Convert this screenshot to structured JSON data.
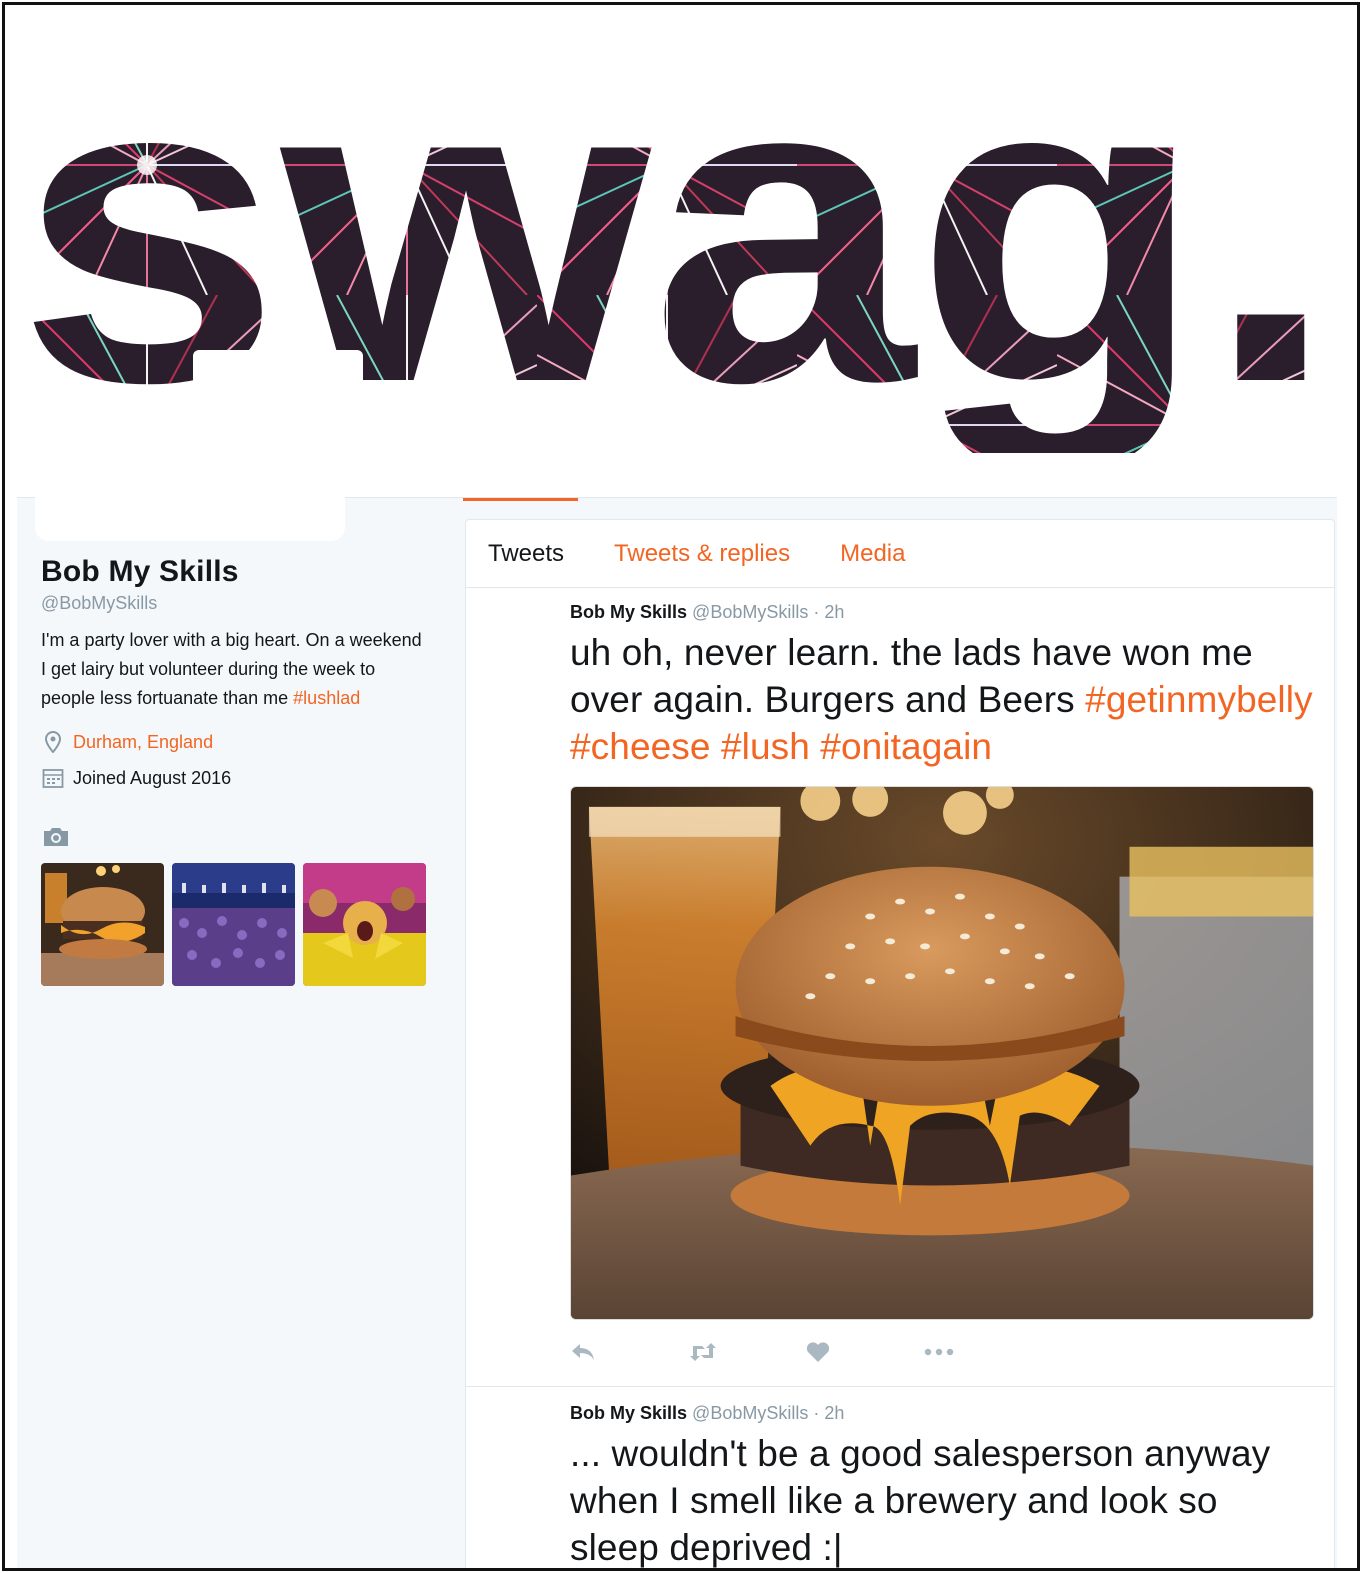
{
  "banner": {
    "word": "swag."
  },
  "profile": {
    "name": "Bob My Skills",
    "handle": "@BobMySkills",
    "bio_text": "I'm a party lover with a big heart. On a weekend I get lairy but volunteer during the week to people less fortuanate than me ",
    "bio_hashtag": "#lushlad",
    "location": "Durham, England",
    "joined": "Joined August 2016"
  },
  "tabs": [
    {
      "label": "Tweets",
      "active": true
    },
    {
      "label": "Tweets & replies",
      "active": false
    },
    {
      "label": "Media",
      "active": false
    }
  ],
  "tweets": [
    {
      "author": "Bob My Skills",
      "meta": "@BobMySkills · 2h",
      "text": "uh oh, never learn. the lads have won me over again. Burgers and Beers",
      "hashtags": "#getinmybelly #cheese #lush #onitagain"
    },
    {
      "author": "Bob My Skills",
      "meta": "@BobMySkills · 2h",
      "text": "... wouldn't be a good salesperson anyway when I smell like a brewery and look so sleep deprived :|",
      "hashtags": ""
    }
  ],
  "colors": {
    "accent": "#f26522",
    "text": "#14171a",
    "muted": "#8899a6",
    "icon": "#aab8c2"
  },
  "icons": [
    "location-icon",
    "calendar-icon",
    "camera-icon",
    "reply-icon",
    "retweet-icon",
    "like-icon",
    "more-icon"
  ]
}
